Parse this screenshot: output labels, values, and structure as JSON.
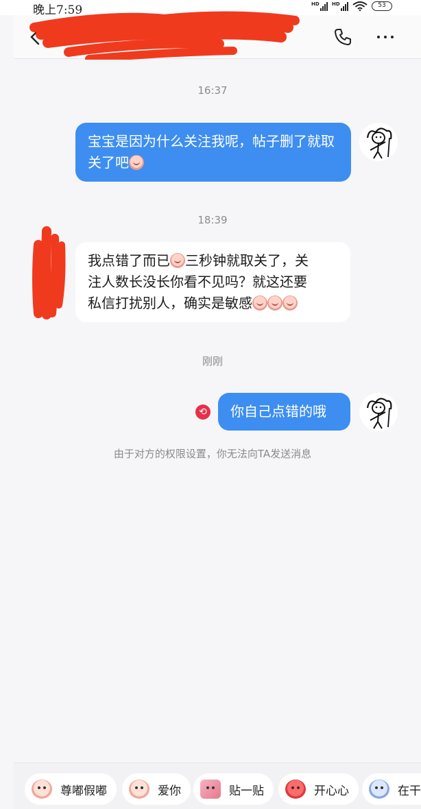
{
  "status_bar": {
    "time": "晚上7:59",
    "signal_label": "HD",
    "battery": "53"
  },
  "header": {
    "contact_name": ""
  },
  "messages": [
    {
      "type": "timestamp",
      "text": "16:37"
    },
    {
      "type": "outgoing",
      "text": "宝宝是因为什么关注我呢，帖子删了就取关了吧",
      "emojis": 1
    },
    {
      "type": "timestamp",
      "text": "18:39"
    },
    {
      "type": "incoming",
      "line1": "我点错了而已",
      "line1b": "三秒钟就取关了，关",
      "line2": "注人数长没长你看不见吗？就这还要",
      "line3": "私信打扰别人，确实是敏感"
    },
    {
      "type": "timestamp",
      "text": "刚刚"
    },
    {
      "type": "outgoing",
      "text": "你自己点错的哦",
      "failed": true
    }
  ],
  "notice": "由于对方的权限设置，你无法向TA发送消息",
  "sticker_bar": {
    "items": [
      {
        "label": "尊嘟假嘟",
        "icon": "pig-face-icon"
      },
      {
        "label": "爱你",
        "icon": "pig-face-icon"
      },
      {
        "label": "贴一贴",
        "icon": "hug-sticker-icon"
      },
      {
        "label": "开心心",
        "icon": "happy-sticker-icon"
      },
      {
        "label": "在干",
        "icon": "face-sticker-icon"
      }
    ]
  },
  "colors": {
    "outgoing_bubble": "#3d8ef0",
    "incoming_bubble": "#ffffff",
    "background": "#f6f6f8",
    "fail_badge": "#e8304a",
    "redaction": "#f03a1e"
  }
}
